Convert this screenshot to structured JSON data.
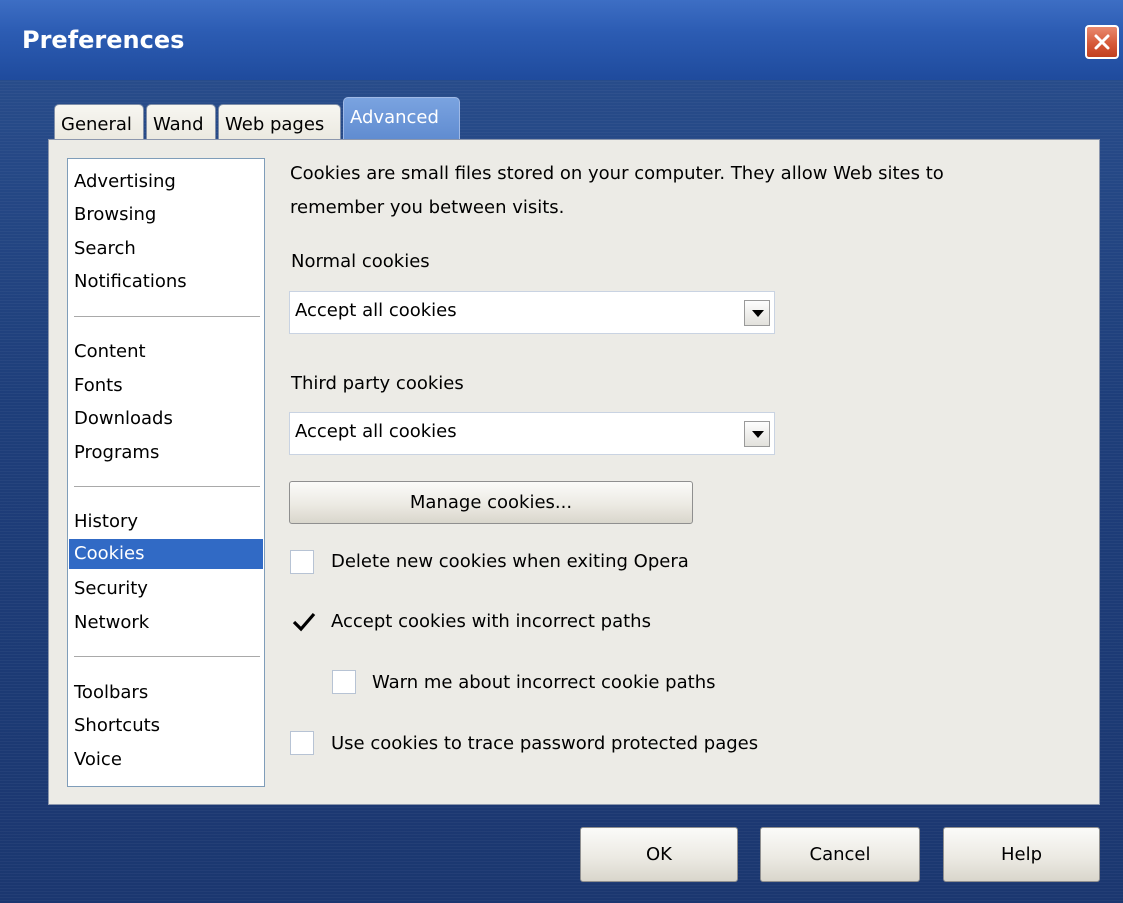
{
  "window": {
    "title": "Preferences"
  },
  "tabs": [
    {
      "label": "General"
    },
    {
      "label": "Wand"
    },
    {
      "label": "Web pages"
    },
    {
      "label": "Advanced",
      "active": true
    }
  ],
  "sidebar": {
    "groups": [
      [
        "Advertising",
        "Browsing",
        "Search",
        "Notifications"
      ],
      [
        "Content",
        "Fonts",
        "Downloads",
        "Programs"
      ],
      [
        "History",
        "Cookies",
        "Security",
        "Network"
      ],
      [
        "Toolbars",
        "Shortcuts",
        "Voice"
      ]
    ],
    "selected": "Cookies"
  },
  "cookies": {
    "description_line1": "Cookies are small files stored on your computer. They allow Web sites to",
    "description_line2": "remember you between visits.",
    "normal_label": "Normal cookies",
    "normal_value": "Accept all cookies",
    "third_party_label": "Third party cookies",
    "third_party_value": "Accept all cookies",
    "manage_button": "Manage cookies...",
    "options": [
      {
        "label": "Delete new cookies when exiting Opera",
        "checked": false
      },
      {
        "label": "Accept cookies with incorrect paths",
        "checked": true
      },
      {
        "label": "Warn me about incorrect cookie paths",
        "checked": false
      },
      {
        "label": "Use cookies to trace password protected pages",
        "checked": false
      }
    ]
  },
  "footer": {
    "ok": "OK",
    "cancel": "Cancel",
    "help": "Help"
  },
  "colors": {
    "selection": "#316ac5",
    "titlebar": "#2c5cb3",
    "close": "#d65a3a"
  }
}
